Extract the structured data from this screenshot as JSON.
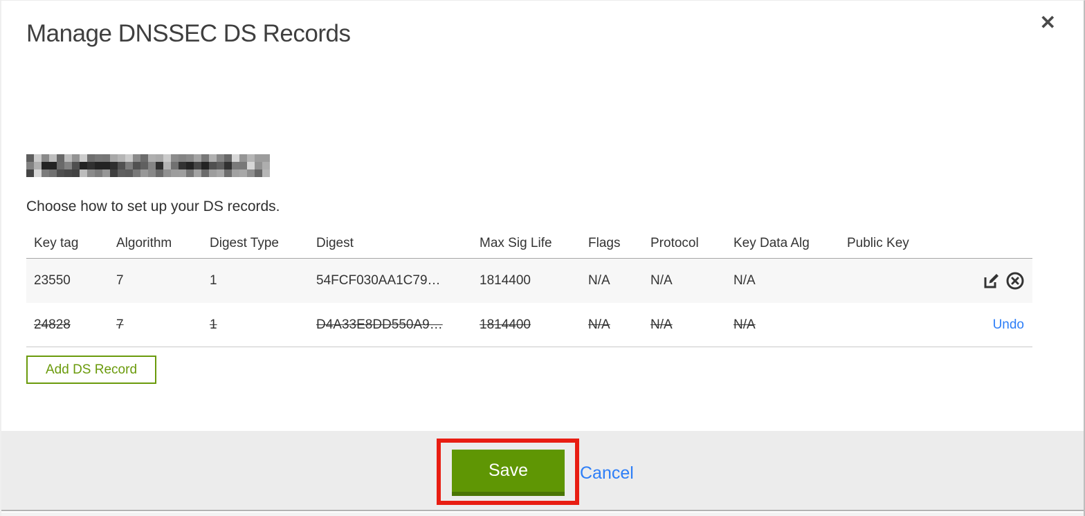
{
  "dialog": {
    "title": "Manage DNSSEC DS Records",
    "close_glyph": "✕",
    "instruction": "Choose how to set up your DS records."
  },
  "table": {
    "columns": [
      "Key tag",
      "Algorithm",
      "Digest Type",
      "Digest",
      "Max Sig Life",
      "Flags",
      "Protocol",
      "Key Data Alg",
      "Public Key"
    ],
    "rows": [
      {
        "key_tag": "23550",
        "algorithm": "7",
        "digest_type": "1",
        "digest": "54FCF030AA1C79…",
        "max_sig_life": "1814400",
        "flags": "N/A",
        "protocol": "N/A",
        "key_data_alg": "N/A",
        "public_key": "",
        "deleted": false
      },
      {
        "key_tag": "24828",
        "algorithm": "7",
        "digest_type": "1",
        "digest": "D4A33E8DD550A9…",
        "max_sig_life": "1814400",
        "flags": "N/A",
        "protocol": "N/A",
        "key_data_alg": "N/A",
        "public_key": "",
        "deleted": true
      }
    ]
  },
  "buttons": {
    "add_ds_record": "Add DS Record",
    "save": "Save",
    "cancel": "Cancel",
    "undo": "Undo"
  },
  "colors": {
    "button_green": "#5f9604",
    "button_green_dark": "#4a7505",
    "outline_green": "#6a9a0b",
    "link_blue": "#2d7ef7",
    "annotation_red": "#e81d12",
    "footer_bg": "#ececec",
    "row_shade": "#f7f7f7"
  }
}
